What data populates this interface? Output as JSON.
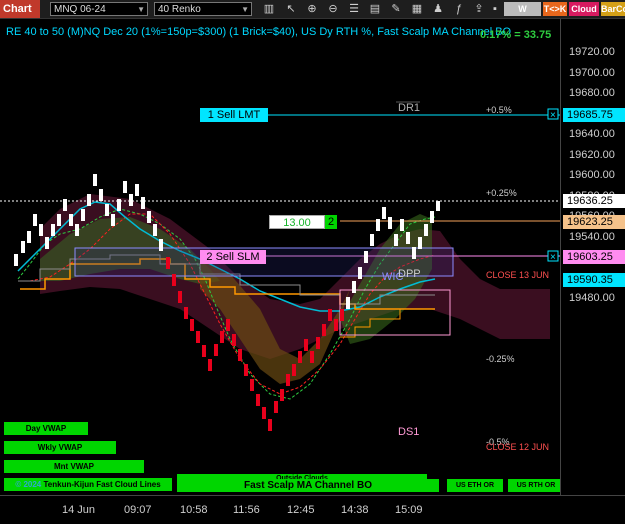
{
  "toolbar": {
    "title": "Chart",
    "instrument": "MNQ 06-24",
    "bar_type": "40 Renko",
    "icons": [
      "bars-icon",
      "pointer-icon",
      "zoom-in-icon",
      "zoom-out-icon",
      "properties-icon",
      "templates-icon",
      "drawing-icon",
      "data-box-icon",
      "strategies-icon",
      "indicators-icon",
      "share-icon",
      "lock-icon"
    ],
    "wvwap": "W VWAP",
    "tk": "T<>K",
    "cloud": "Cloud",
    "barco": "BarCo"
  },
  "header": {
    "text": "RE 40 to 50 (M)NQ Dec 20 (1%=150p=$300) (1 Brick=$40), US Dy RTH %, Fast Scalp MA Channel BO",
    "gain": "0.17% = 33.75"
  },
  "chart_data": {
    "type": "renko",
    "y_range": [
      19470,
      19740
    ],
    "y_ticks": [
      "19720.00",
      "19700.00",
      "19680.00",
      "19660.00",
      "19640.00",
      "19620.00",
      "19600.00",
      "19580.00",
      "19560.00",
      "19540.00",
      "19520.00",
      "19500.00",
      "19480.00"
    ],
    "x_ticks": [
      "14 Jun",
      "09:07",
      "10:58",
      "11:56",
      "12:45",
      "14:38",
      "15:09"
    ],
    "price_tags": [
      {
        "value": "19685.75",
        "color": "#00e5ff"
      },
      {
        "value": "19636.25",
        "color": "#ffffff"
      },
      {
        "value": "19623.25",
        "color": "#f5c28a"
      },
      {
        "value": "19603.25",
        "color": "#ff8cf0"
      },
      {
        "value": "19590.35",
        "color": "#00e5ff"
      }
    ],
    "levels": [
      {
        "label": "DR1",
        "value": 19683
      },
      {
        "label": "+0.5%",
        "value": 19683
      },
      {
        "label": "+0.25%",
        "value": 19640
      },
      {
        "label": "DPP",
        "value": 19598
      },
      {
        "label": "CLOSE 13 JUN",
        "value": 19590
      },
      {
        "label": "-0.25%",
        "value": 19540
      },
      {
        "label": "DS1",
        "value": 19500
      },
      {
        "label": "-0.5%",
        "value": 19497
      },
      {
        "label": "CLOSE 12 JUN",
        "value": 19494
      }
    ]
  },
  "orders": {
    "sell_lmt": "1 Sell LMT",
    "sell_slm": "2 Sell SLM",
    "qty": "13.00",
    "qty_count": "2",
    "wick_label": "WIC"
  },
  "bottom_buttons": {
    "day_vwap": "Day VWAP",
    "wkly_vwap": "Wkly VWAP",
    "mnt_vwap": "Mnt VWAP",
    "outside_clouds": "Outside Clouds",
    "fast_scalp": "Fast Scalp MA Channel BO",
    "us_eth_or": "US ETH OR",
    "us_rth_or": "US RTH OR",
    "tenkun": "Tenkun-Kijun Fast Cloud Lines",
    "copyright": "© 2024"
  }
}
